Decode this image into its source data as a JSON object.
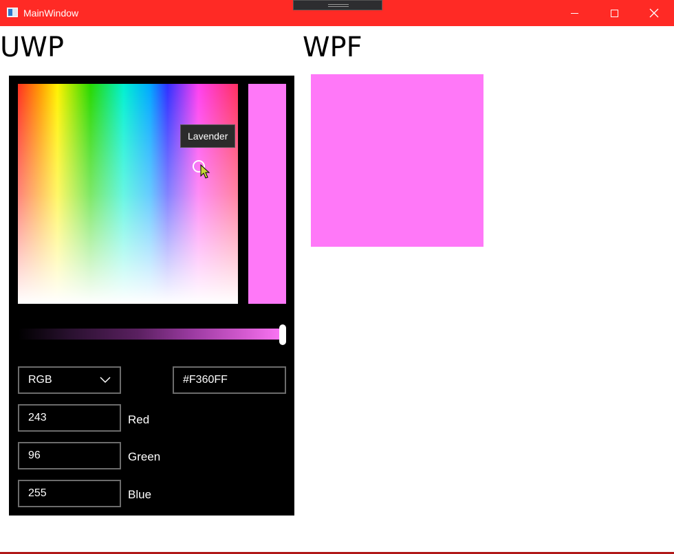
{
  "window": {
    "title": "MainWindow"
  },
  "sections": {
    "uwp_heading": "UWP",
    "wpf_heading": "WPF"
  },
  "color_picker": {
    "tooltip": "Lavender",
    "mode_selected": "RGB",
    "hex_value": "#F360FF",
    "channels": [
      {
        "value": "243",
        "label": "Red"
      },
      {
        "value": "96",
        "label": "Green"
      },
      {
        "value": "255",
        "label": "Blue"
      }
    ],
    "value_slider_fraction": 1.0,
    "preview_color": "#ff78f8"
  },
  "wpf_preview_color": "#ff78f8",
  "accent_color": "#ff2a25",
  "icons": [
    "app-icon",
    "minimize-icon",
    "maximize-icon",
    "close-icon",
    "chevron-down-icon",
    "mouse-cursor-icon"
  ]
}
